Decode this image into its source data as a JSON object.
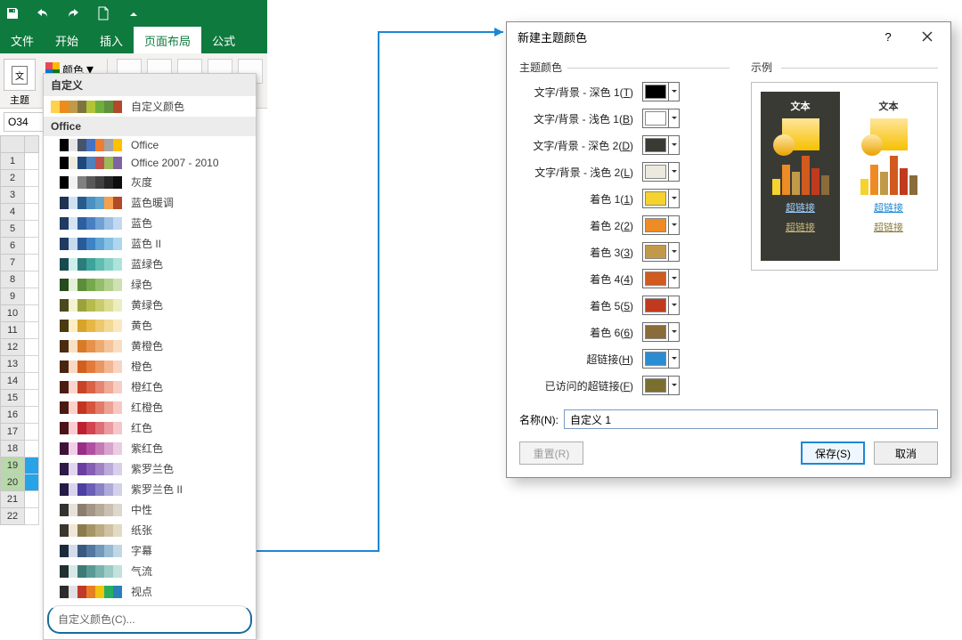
{
  "qat": {
    "icons": [
      "save",
      "undo",
      "redo",
      "new",
      "customize"
    ]
  },
  "tabs": {
    "file": "文件",
    "home": "开始",
    "insert": "插入",
    "pagelayout": "页面布局",
    "formulas": "公式"
  },
  "ribbon": {
    "themes": "主题",
    "colors": "颜色"
  },
  "namebox": "O34",
  "row_numbers": [
    1,
    2,
    3,
    4,
    5,
    6,
    7,
    8,
    9,
    10,
    11,
    12,
    13,
    14,
    15,
    16,
    17,
    18,
    19,
    20,
    21,
    22
  ],
  "dropdown": {
    "custom_header": "自定义",
    "custom_label": "自定义颜色",
    "custom_swatches": [
      "#ffd24d",
      "#ec8c1a",
      "#c19a49",
      "#7f7440",
      "#b1c436",
      "#6fae3a",
      "#60913e",
      "#b24a2a"
    ],
    "office_header": "Office",
    "themes": [
      {
        "label": "Office",
        "c": [
          "#ffffff",
          "#000000",
          "#e7e6e6",
          "#44546a",
          "#4472c4",
          "#ed7d31",
          "#a5a5a5",
          "#ffc000"
        ]
      },
      {
        "label": "Office 2007 - 2010",
        "c": [
          "#ffffff",
          "#000000",
          "#eeece1",
          "#1f497d",
          "#4f81bd",
          "#c0504d",
          "#9bbb59",
          "#8064a2"
        ]
      },
      {
        "label": "灰度",
        "c": [
          "#ffffff",
          "#000000",
          "#f2f2f2",
          "#808080",
          "#595959",
          "#404040",
          "#262626",
          "#0d0d0d"
        ]
      },
      {
        "label": "蓝色暖调",
        "c": [
          "#ffffff",
          "#1f3251",
          "#cde1f1",
          "#285a8e",
          "#4a90c3",
          "#62a6d0",
          "#f6a04d",
          "#b24a2a"
        ]
      },
      {
        "label": "蓝色",
        "c": [
          "#ffffff",
          "#1f3b60",
          "#d5e3f3",
          "#2d5fa0",
          "#4a7fc1",
          "#6fa2d4",
          "#9bc0e4",
          "#c2d9ef"
        ]
      },
      {
        "label": "蓝色 II",
        "c": [
          "#ffffff",
          "#1f3b60",
          "#c7dbee",
          "#2a5b99",
          "#3d83c6",
          "#5fa6d6",
          "#86c1e2",
          "#aed6ec"
        ]
      },
      {
        "label": "蓝绿色",
        "c": [
          "#ffffff",
          "#194a4f",
          "#cdeeea",
          "#2a7d7c",
          "#3ea39a",
          "#5fbdb1",
          "#86d1c6",
          "#aee2da"
        ]
      },
      {
        "label": "绿色",
        "c": [
          "#ffffff",
          "#274a1f",
          "#e3efd7",
          "#5b8e39",
          "#76a84d",
          "#93be6a",
          "#b1d08d",
          "#cfe1b3"
        ]
      },
      {
        "label": "黄绿色",
        "c": [
          "#ffffff",
          "#4a4a1f",
          "#f3f3cf",
          "#9aa33a",
          "#b6bb4e",
          "#c9cc6b",
          "#dbdd93",
          "#ecedc0"
        ]
      },
      {
        "label": "黄色",
        "c": [
          "#ffffff",
          "#4a3b11",
          "#fbeec3",
          "#d8a328",
          "#e6b647",
          "#eec86d",
          "#f4d996",
          "#f9e8c1"
        ]
      },
      {
        "label": "黄橙色",
        "c": [
          "#ffffff",
          "#4a2c12",
          "#f9e0c3",
          "#d87a28",
          "#e6924a",
          "#eeab70",
          "#f4c59a",
          "#f9ddc3"
        ]
      },
      {
        "label": "橙色",
        "c": [
          "#ffffff",
          "#4a2512",
          "#f9d9c3",
          "#d35f1e",
          "#e37a3b",
          "#ec9762",
          "#f3b692",
          "#f9d4c2"
        ]
      },
      {
        "label": "橙红色",
        "c": [
          "#ffffff",
          "#4a1d12",
          "#fbd4cb",
          "#c94327",
          "#db6246",
          "#e6866f",
          "#efaa9a",
          "#f7cec4"
        ]
      },
      {
        "label": "红橙色",
        "c": [
          "#ffffff",
          "#4a1812",
          "#fbd1ca",
          "#c33521",
          "#d7553f",
          "#e37b67",
          "#edA294",
          "#f6c9c1"
        ]
      },
      {
        "label": "红色",
        "c": [
          "#ffffff",
          "#4a1218",
          "#fbccd0",
          "#be2030",
          "#d2444f",
          "#df6f77",
          "#eb9ba1",
          "#f6c7ca"
        ]
      },
      {
        "label": "紫红色",
        "c": [
          "#ffffff",
          "#3e1238",
          "#f1cfe9",
          "#9a2d86",
          "#b150a0",
          "#c47ab7",
          "#d7a4ce",
          "#e9cde3"
        ]
      },
      {
        "label": "紫罗兰色",
        "c": [
          "#ffffff",
          "#2d1a45",
          "#e2d5ef",
          "#6b3fa0",
          "#855fb5",
          "#a083c7",
          "#bcaada",
          "#d8d0eb"
        ]
      },
      {
        "label": "紫罗兰色 II",
        "c": [
          "#ffffff",
          "#241a45",
          "#d9d3ef",
          "#4c3fa0",
          "#6a5fb5",
          "#8b83c7",
          "#afaad9",
          "#d3d0eb"
        ]
      },
      {
        "label": "中性",
        "c": [
          "#ffffff",
          "#333230",
          "#e6e2db",
          "#8a7f6f",
          "#a39685",
          "#b7ab9a",
          "#cbc1b2",
          "#ded7cb"
        ]
      },
      {
        "label": "纸张",
        "c": [
          "#ffffff",
          "#3a362d",
          "#efe8d6",
          "#8c7b4e",
          "#a79466",
          "#bcab83",
          "#d0c2a2",
          "#e3dac3"
        ]
      },
      {
        "label": "字幕",
        "c": [
          "#ffffff",
          "#1a2a3a",
          "#d2ddea",
          "#3a5980",
          "#5278a2",
          "#739abd",
          "#99bad3",
          "#c0d7e6"
        ]
      },
      {
        "label": "气流",
        "c": [
          "#ffffff",
          "#203030",
          "#d8e8e6",
          "#3e7a77",
          "#5a9a95",
          "#7ab4ae",
          "#9ecbc6",
          "#c3e1dd"
        ]
      },
      {
        "label": "视点",
        "c": [
          "#ffffff",
          "#2c2c2c",
          "#e1e1e1",
          "#c0392b",
          "#e67e22",
          "#f1c40f",
          "#27ae60",
          "#2980b9"
        ]
      }
    ],
    "custom_cmd": "自定义颜色(C)..."
  },
  "dialog": {
    "title": "新建主题颜色",
    "group_theme": "主题颜色",
    "group_preview": "示例",
    "rows": [
      {
        "label": "文字/背景 - 深色 1(",
        "u": "T",
        "tail": ")",
        "color": "#000000"
      },
      {
        "label": "文字/背景 - 浅色 1(",
        "u": "B",
        "tail": ")",
        "color": "#ffffff"
      },
      {
        "label": "文字/背景 - 深色 2(",
        "u": "D",
        "tail": ")",
        "color": "#3a3a35"
      },
      {
        "label": "文字/背景 - 浅色 2(",
        "u": "L",
        "tail": ")",
        "color": "#ece9de"
      },
      {
        "label": "着色 1(",
        "u": "1",
        "tail": ")",
        "color": "#f6d22e"
      },
      {
        "label": "着色 2(",
        "u": "2",
        "tail": ")",
        "color": "#ef8b24"
      },
      {
        "label": "着色 3(",
        "u": "3",
        "tail": ")",
        "color": "#c19a49"
      },
      {
        "label": "着色 4(",
        "u": "4",
        "tail": ")",
        "color": "#d15a1e"
      },
      {
        "label": "着色 5(",
        "u": "5",
        "tail": ")",
        "color": "#c13a1e"
      },
      {
        "label": "着色 6(",
        "u": "6",
        "tail": ")",
        "color": "#8a6b3a"
      },
      {
        "label": "超链接(",
        "u": "H",
        "tail": ")",
        "color": "#2a8dd4"
      },
      {
        "label": "已访问的超链接(",
        "u": "F",
        "tail": ")",
        "color": "#7a6f2f"
      }
    ],
    "preview": {
      "text": "文本",
      "hyper": "超链接",
      "followed": "超链接"
    },
    "chart": [
      "#f6d22e",
      "#ef8b24",
      "#c19a49",
      "#d15a1e",
      "#c13a1e",
      "#8a6b3a"
    ],
    "heights": [
      18,
      34,
      26,
      44,
      30,
      22
    ],
    "name_label": "名称(N):",
    "name_value": "自定义 1",
    "reset": "重置(R)",
    "save": "保存(S)",
    "cancel": "取消"
  }
}
